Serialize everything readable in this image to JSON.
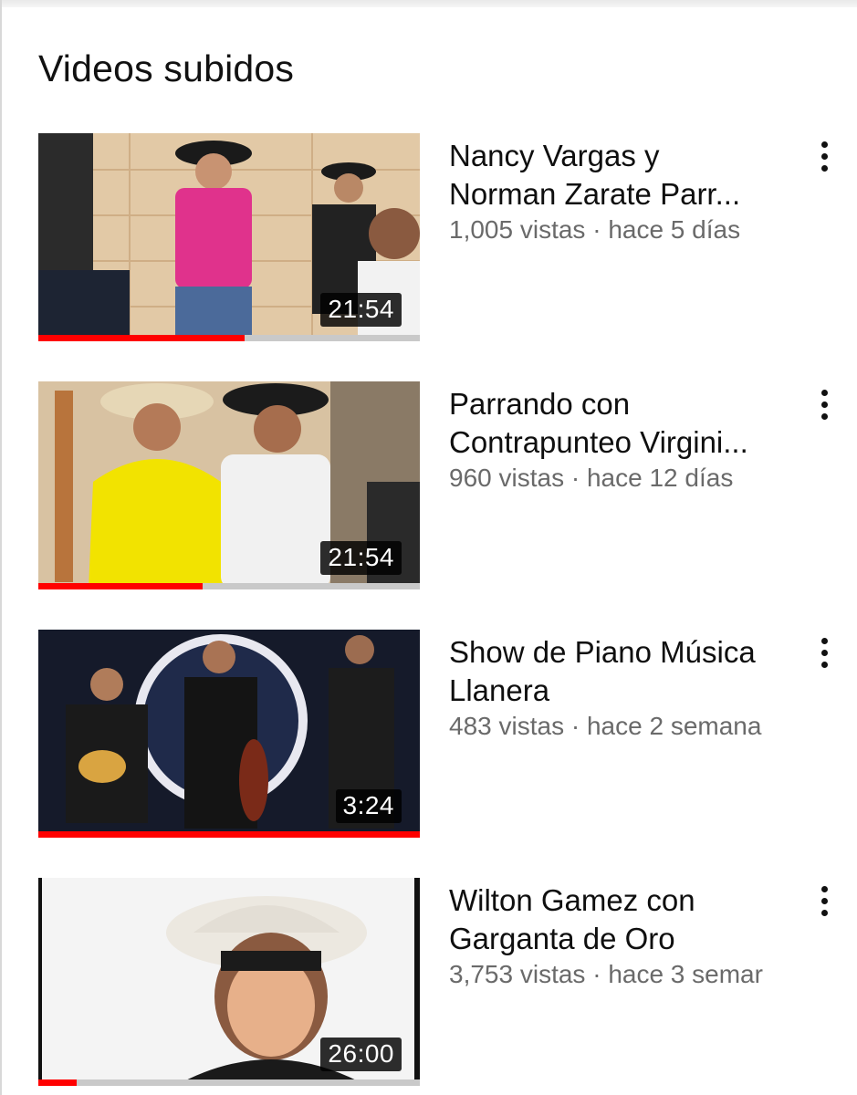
{
  "section": {
    "title": "Videos subidos"
  },
  "videos": [
    {
      "title_line1": "Nancy Vargas y",
      "title_line2": "Norman Zarate Parr...",
      "views": "1,005 vistas",
      "age": "hace 5 días",
      "duration": "21:54",
      "watched_fraction": 0.54
    },
    {
      "title_line1": "Parrando con",
      "title_line2": "Contrapunteo Virgini...",
      "views": "960 vistas",
      "age": "hace 12 días",
      "duration": "21:54",
      "watched_fraction": 0.43
    },
    {
      "title_line1": "Show de Piano Música",
      "title_line2": "Llanera",
      "views": "483 vistas",
      "age": "hace 2 semana",
      "duration": "3:24",
      "watched_fraction": 1.0
    },
    {
      "title_line1": "Wilton Gamez con",
      "title_line2": "Garganta de Oro",
      "views": "3,753 vistas",
      "age": "hace 3 semar",
      "duration": "26:00",
      "watched_fraction": 0.1
    }
  ],
  "icons": {
    "menu": "more-vert-icon"
  },
  "colors": {
    "progress": "#ff0000",
    "meta_text": "#6a6a6a"
  }
}
